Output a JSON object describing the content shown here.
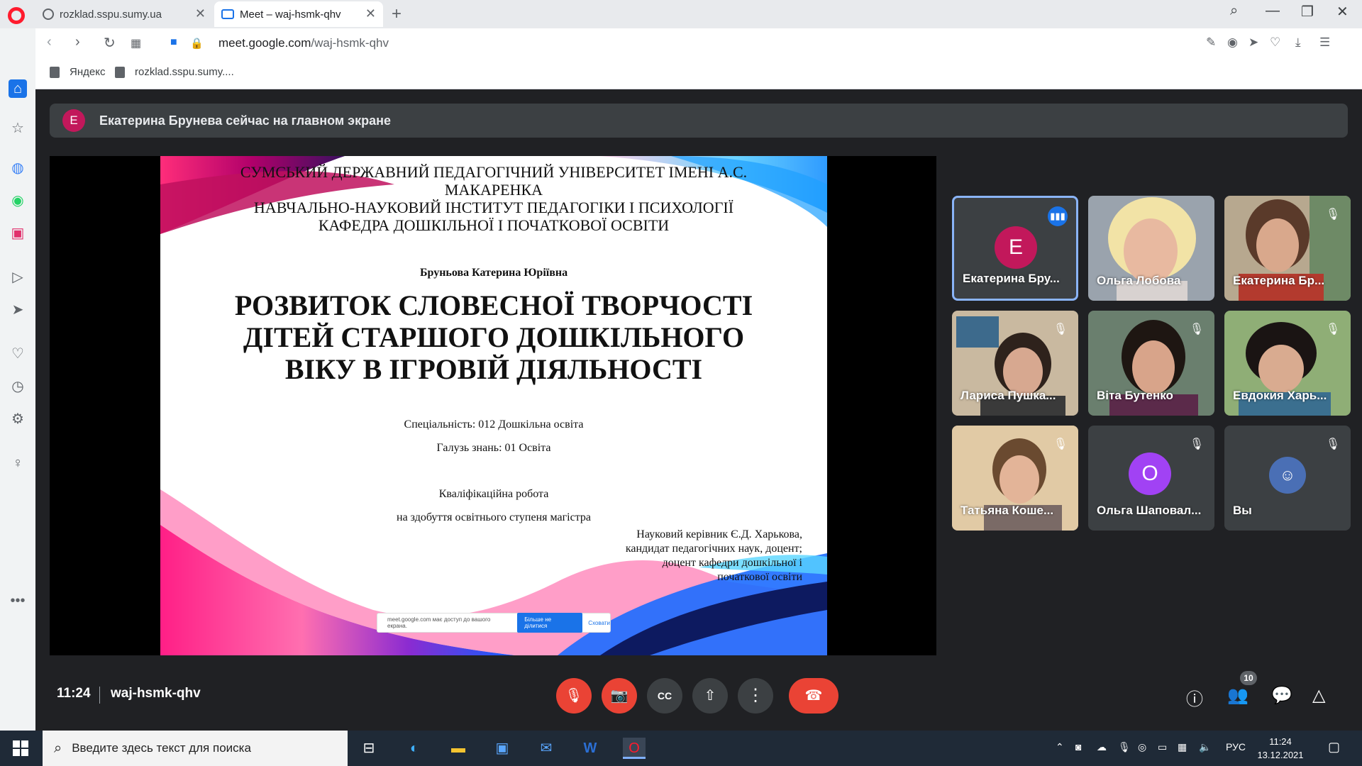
{
  "browser": {
    "tabs": [
      {
        "title": "rozklad.sspu.sumy.ua"
      },
      {
        "title": "Meet – waj-hsmk-qhv"
      }
    ],
    "url_host": "meet.google.com",
    "url_path": "/waj-hsmk-qhv",
    "bookmarks": [
      {
        "label": "Яндекс"
      },
      {
        "label": "rozklad.sspu.sumy...."
      }
    ]
  },
  "meet": {
    "banner": {
      "avatar_letter": "E",
      "text": "Екатерина Брунева сейчас на главном экране"
    },
    "slide": {
      "header": [
        "СУМСЬКИЙ ДЕРЖАВНИЙ ПЕДАГОГІЧНИЙ УНІВЕРСИТЕТ ІМЕНІ А.С.",
        "МАКАРЕНКА",
        "НАВЧАЛЬНО-НАУКОВИЙ ІНСТИТУТ ПЕДАГОГІКИ І ПСИХОЛОГІЇ",
        "КАФЕДРА ДОШКІЛЬНОЇ І ПОЧАТКОВОЇ ОСВІТИ"
      ],
      "author": "Бруньова Катерина Юріївна",
      "title": [
        "РОЗВИТОК СЛОВЕСНОЇ ТВОРЧОСТІ",
        "ДІТЕЙ СТАРШОГО ДОШКІЛЬНОГО",
        "ВІКУ В ІГРОВІЙ ДІЯЛЬНОСТІ"
      ],
      "specialty": "Спеціальність: 012 Дошкільна освіта",
      "branch": "Галузь знань: 01 Освіта",
      "qualification": "Кваліфікаційна робота",
      "degree": "на здобуття освітнього ступеня магістра",
      "supervisor": [
        "Науковий керівник Є.Д. Харькова,",
        "кандидат педагогічних наук, доцент;",
        "доцент кафедри дошкільної і",
        "початкової освіти"
      ],
      "share_notice": {
        "text": "meet.google.com має доступ до вашого екрана.",
        "stop_label": "Більше не ділитися",
        "hide_label": "Сховати"
      }
    },
    "participants": [
      {
        "name": "Екатерина Бру...",
        "avatar_letter": "E",
        "avatar_color": "#c2185b",
        "state": "speaking"
      },
      {
        "name": "Ольга Лобова",
        "state": "video"
      },
      {
        "name": "Екатерина Бр...",
        "state": "muted"
      },
      {
        "name": "Лариса Пушка...",
        "state": "muted"
      },
      {
        "name": "Віта Бутенко",
        "state": "muted"
      },
      {
        "name": "Евдокия Харь...",
        "state": "muted"
      },
      {
        "name": "Татьяна Коше...",
        "state": "muted"
      },
      {
        "name": "Ольга Шаповал...",
        "avatar_letter": "O",
        "avatar_color": "#a142f4",
        "state": "muted"
      },
      {
        "name": "Вы",
        "state": "muted"
      }
    ],
    "controls": {
      "time": "11:24",
      "meeting_code": "waj-hsmk-qhv",
      "participant_count": "10"
    }
  },
  "taskbar": {
    "search_placeholder": "Введите здесь текст для поиска",
    "language": "РУС",
    "clock_time": "11:24",
    "clock_date": "13.12.2021"
  }
}
